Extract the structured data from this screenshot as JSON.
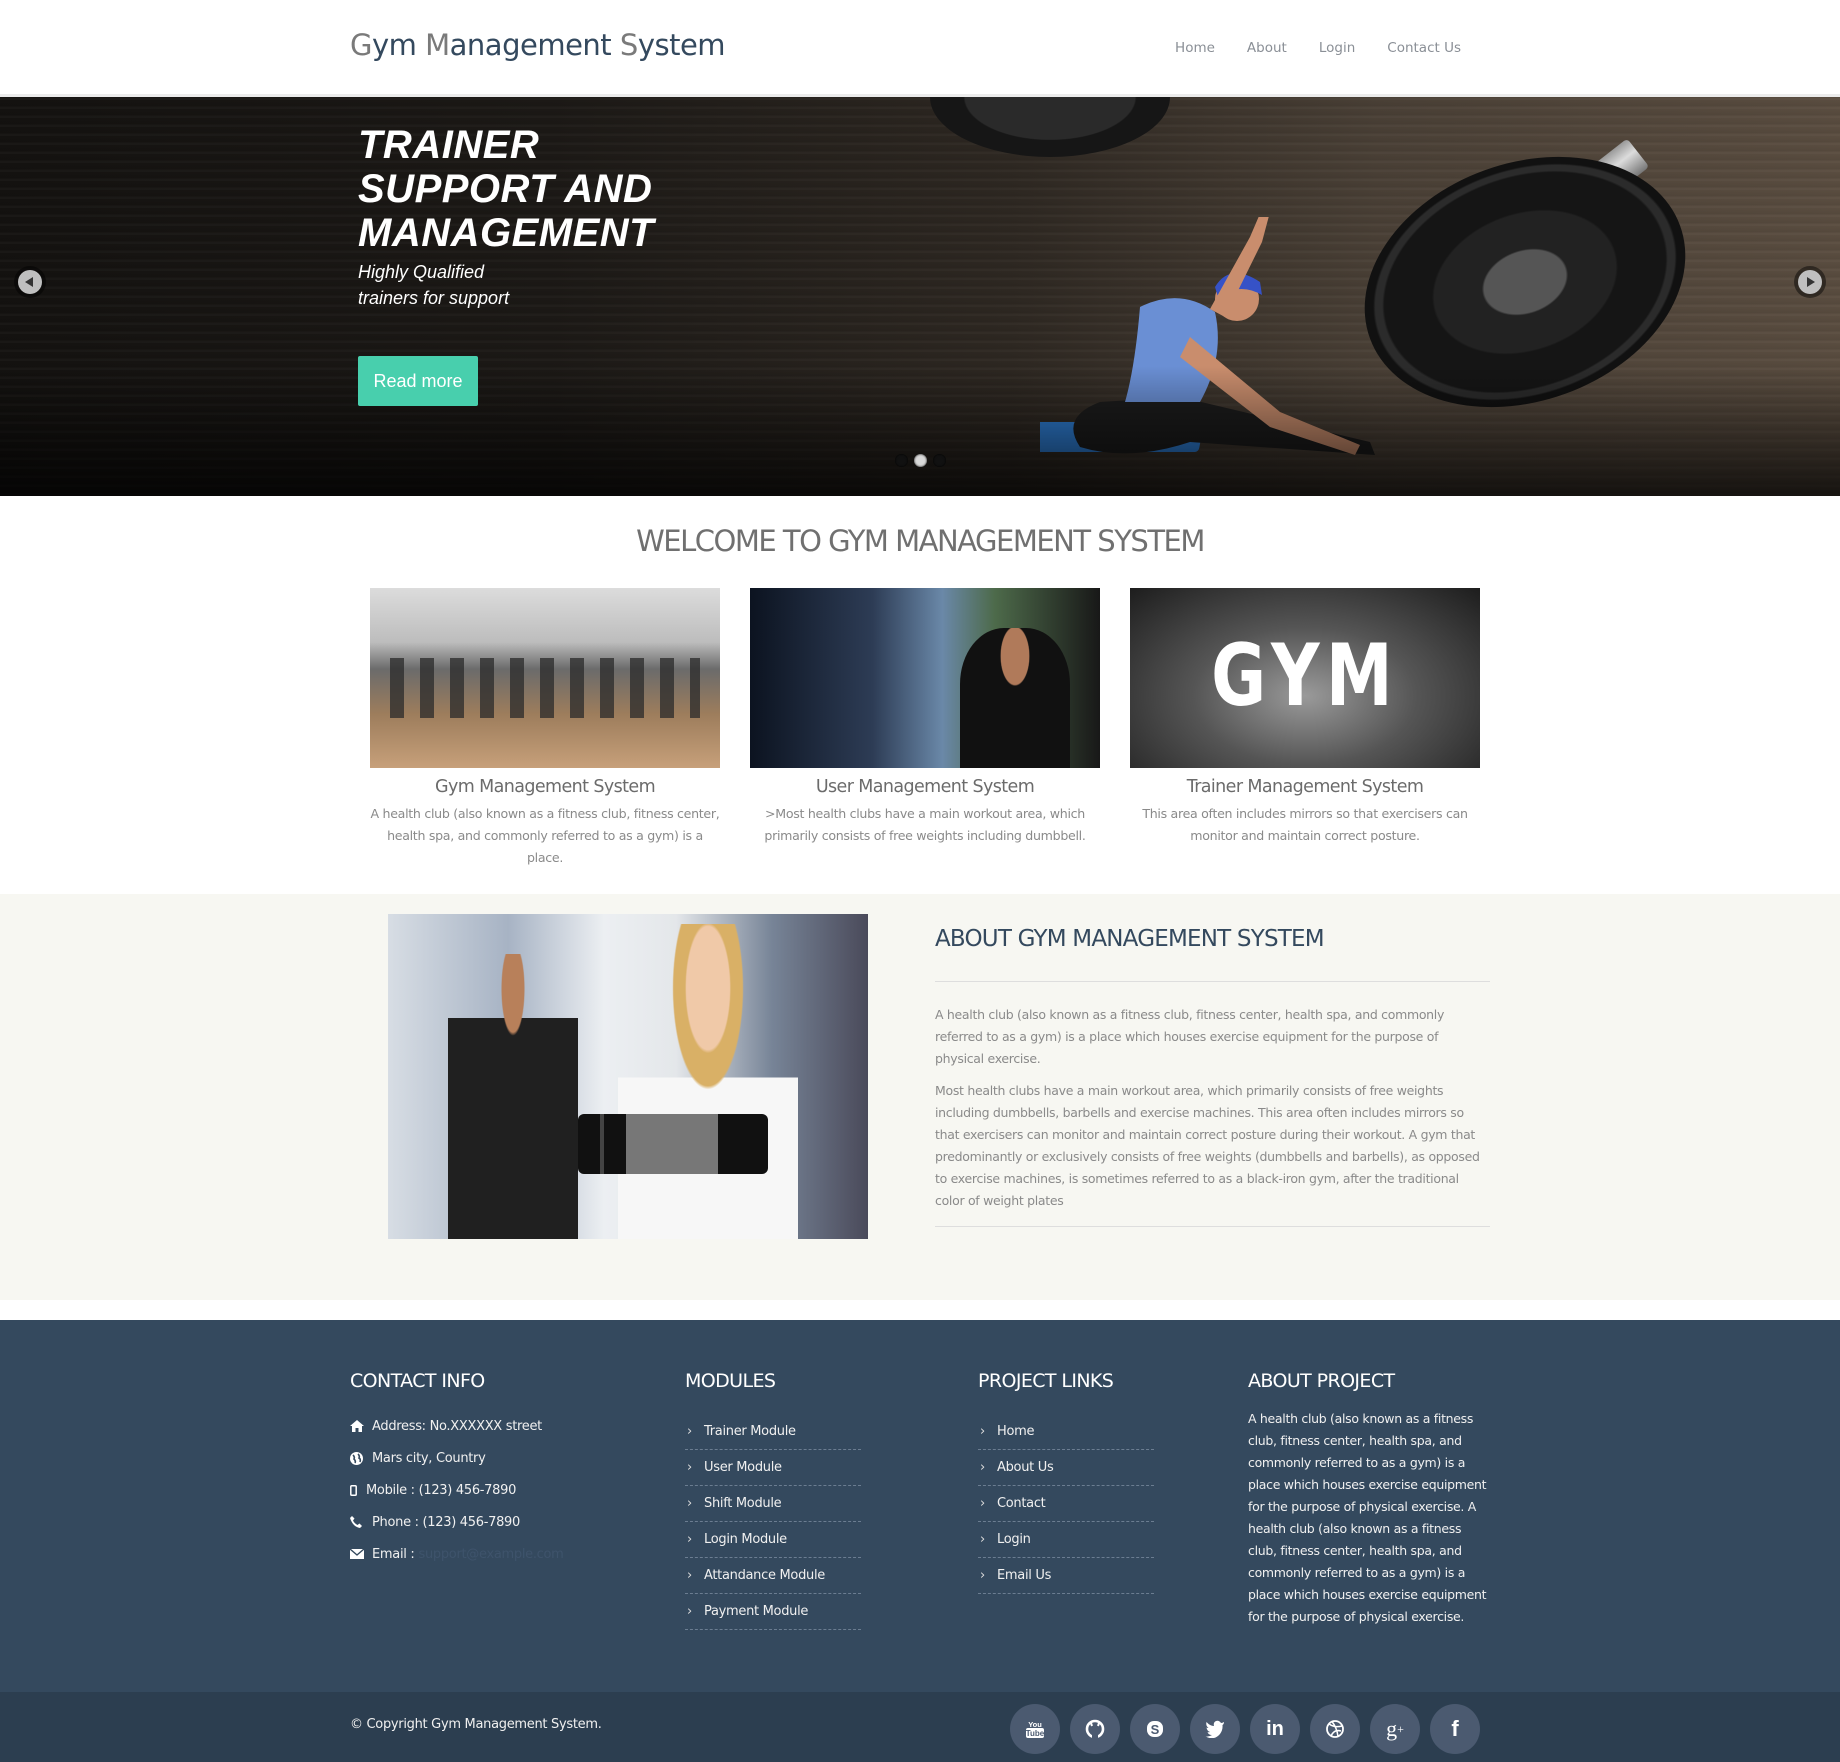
{
  "header": {
    "brand_parts": [
      {
        "cap": "G",
        "rest": "ym "
      },
      {
        "cap": "M",
        "rest": "anagement "
      },
      {
        "cap": "S",
        "rest": "ystem"
      }
    ],
    "nav": [
      "Home",
      "About",
      "Login",
      "Contact Us"
    ]
  },
  "hero": {
    "title": "TRAINER SUPPORT AND MANAGEMENT",
    "subtitle": "Highly Qualified trainers for support",
    "button": "Read more",
    "slides": 3,
    "active_slide": 2,
    "colors": {
      "button": "#48cfad"
    }
  },
  "welcome": {
    "heading": "WELCOME TO GYM MANAGEMENT SYSTEM",
    "cards": [
      {
        "title": "Gym Management System",
        "text": "A health club (also known as a fitness club, fitness center, health spa, and commonly referred to as a gym) is a place.",
        "image": "gym-interior-photo"
      },
      {
        "title": "User Management System",
        "text": ">Most health clubs have a main workout area, which primarily consists of free weights including dumbbell.",
        "image": "man-lifting-dumbbell-photo"
      },
      {
        "title": "Trainer Management System",
        "text": "This area often includes mirrors so that exercisers can monitor and maintain correct posture.",
        "image_text": "GYM",
        "image": "dumbbells-gym-text-photo"
      }
    ]
  },
  "about": {
    "heading": "ABOUT GYM MANAGEMENT SYSTEM",
    "paragraphs": [
      "A health club (also known as a fitness club, fitness center, health spa, and commonly referred to as a gym) is a place which houses exercise equipment for the purpose of physical exercise.",
      "Most health clubs have a main workout area, which primarily consists of free weights including dumbbells, barbells and exercise machines. This area often includes mirrors so that exercisers can monitor and maintain correct posture during their workout. A gym that predominantly or exclusively consists of free weights (dumbbells and barbells), as opposed to exercise machines, is sometimes referred to as a black-iron gym, after the traditional color of weight plates"
    ]
  },
  "footer": {
    "contact": {
      "heading": "CONTACT INFO",
      "items": [
        {
          "icon": "home-icon",
          "text": "Address: No.XXXXXX street"
        },
        {
          "icon": "globe-icon",
          "text": "Mars city, Country"
        },
        {
          "icon": "mobile-icon",
          "text": "Mobile : (123) 456-7890"
        },
        {
          "icon": "phone-icon",
          "text": "Phone : (123) 456-7890"
        },
        {
          "icon": "envelope-icon",
          "text": "Email :"
        }
      ],
      "email_value": "support@example.com"
    },
    "modules": {
      "heading": "MODULES",
      "items": [
        "Trainer Module",
        "User Module",
        "Shift Module",
        "Login Module",
        "Attandance Module",
        "Payment Module"
      ]
    },
    "project_links": {
      "heading": "PROJECT LINKS",
      "items": [
        "Home",
        "About Us",
        "Contact",
        "Login",
        "Email Us"
      ]
    },
    "about_project": {
      "heading": "ABOUT PROJECT",
      "text": "A health club (also known as a fitness club, fitness center, health spa, and commonly referred to as a gym) is a place which houses exercise equipment for the purpose of physical exercise. A health club (also known as a fitness club, fitness center, health spa, and commonly referred to as a gym) is a place which houses exercise equipment for the purpose of physical exercise."
    },
    "copyright": "© Copyright Gym Management System.",
    "social": [
      "youtube-icon",
      "github-icon",
      "skype-icon",
      "twitter-icon",
      "linkedin-icon",
      "dribbble-icon",
      "google-plus-icon",
      "facebook-icon"
    ],
    "colors": {
      "background": "#34495e",
      "bottom_bar": "#2c3e50",
      "social_circle": "#4b5a70"
    }
  }
}
